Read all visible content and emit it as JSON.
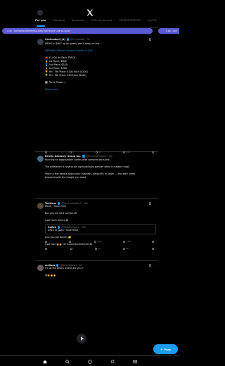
{
  "header": {
    "logo": "x-logo-icon"
  },
  "tabs": [
    {
      "label": "For you",
      "active": true
    },
    {
      "label": "Following",
      "active": false
    },
    {
      "label": "Electronic",
      "active": false
    },
    {
      "label": "YGG Community",
      "active": false
    },
    {
      "label": "SPORTSCRYPTO4",
      "active": false
    },
    {
      "label": "CryTOk",
      "active": false
    }
  ],
  "ticker": {
    "text": "1.3K · OUTSIDER DECENTRALIZED WHITELIST LIVE 1K $OUT",
    "text2": "1.8K · OUT"
  },
  "posts": [
    {
      "name": "Cavtradeol (yt)",
      "handle": "@CryptoMH · 3h",
      "lines": [
        "$8000 in $MIC up for grabs, don't sleep on this",
        "",
        "@Misbits_Official Content Contest is LIVE",
        "",
        "📣 $3,000 for Each TRACK",
        "🥇 1st Place: $800",
        "🥈 2nd Place: $550",
        "🥉 3rd Place: $300",
        "🏆 4th - 5th Place: $100 Each ($200)",
        "🏆 7th - 9th Place: $50 Each ($200)",
        "",
        "🗓 Three Tracks ↓"
      ],
      "show_more": "Show more",
      "stats": {
        "reply": "",
        "repost": "1",
        "like": "10",
        "views": "194"
      }
    },
    {
      "name": "Driven Advisory Group Inc.",
      "handle": "@DrivenAdvisory · Ad",
      "lines": [
        "Running an organization comes with complex decisions.",
        "",
        "The difference is having the right advisory partner when it matters most.",
        "",
        "Share a few details about your business, nonprofit, or team — and we'll come",
        "prepared with the insight you need."
      ],
      "stats": {
        "reply": "",
        "repost": "",
        "like": "",
        "views": ""
      }
    },
    {
      "name": "Textious",
      "handle": "@CavtradeWeb3 · 16h",
      "lines": [
        "Done, I have mine",
        "",
        "But you are $3.4 and $2.2K",
        "",
        "I got them plenty 😅"
      ],
      "quote": {
        "name": "Sufiah",
        "handle": "@SufiahCrypto · 16h",
        "text": "when ur gaan i have mine"
      },
      "after": [
        "",
        "And you are dennis 🤔",
        "",
        "I got ther 🔥🔥 ter x.com/Sentinel/12345"
      ],
      "stats": {
        "reply": "",
        "repost": "1",
        "like": "1.4K",
        "views": "7.4M"
      },
      "stats2": {
        "reply": "",
        "repost": "",
        "like": "71",
        "views": "957"
      }
    },
    {
      "name": "melisss",
      "handle": "@StrellaWeb3 · 8h",
      "lines": [
        "I'm at the beach where are you ?",
        "",
        "😍🔥🔥🔥"
      ]
    }
  ],
  "post_button": {
    "label": "Post",
    "icon": "plus-icon"
  },
  "bottom_nav": [
    "home-icon",
    "search-icon",
    "grok-icon",
    "notifications-icon",
    "messages-icon"
  ]
}
